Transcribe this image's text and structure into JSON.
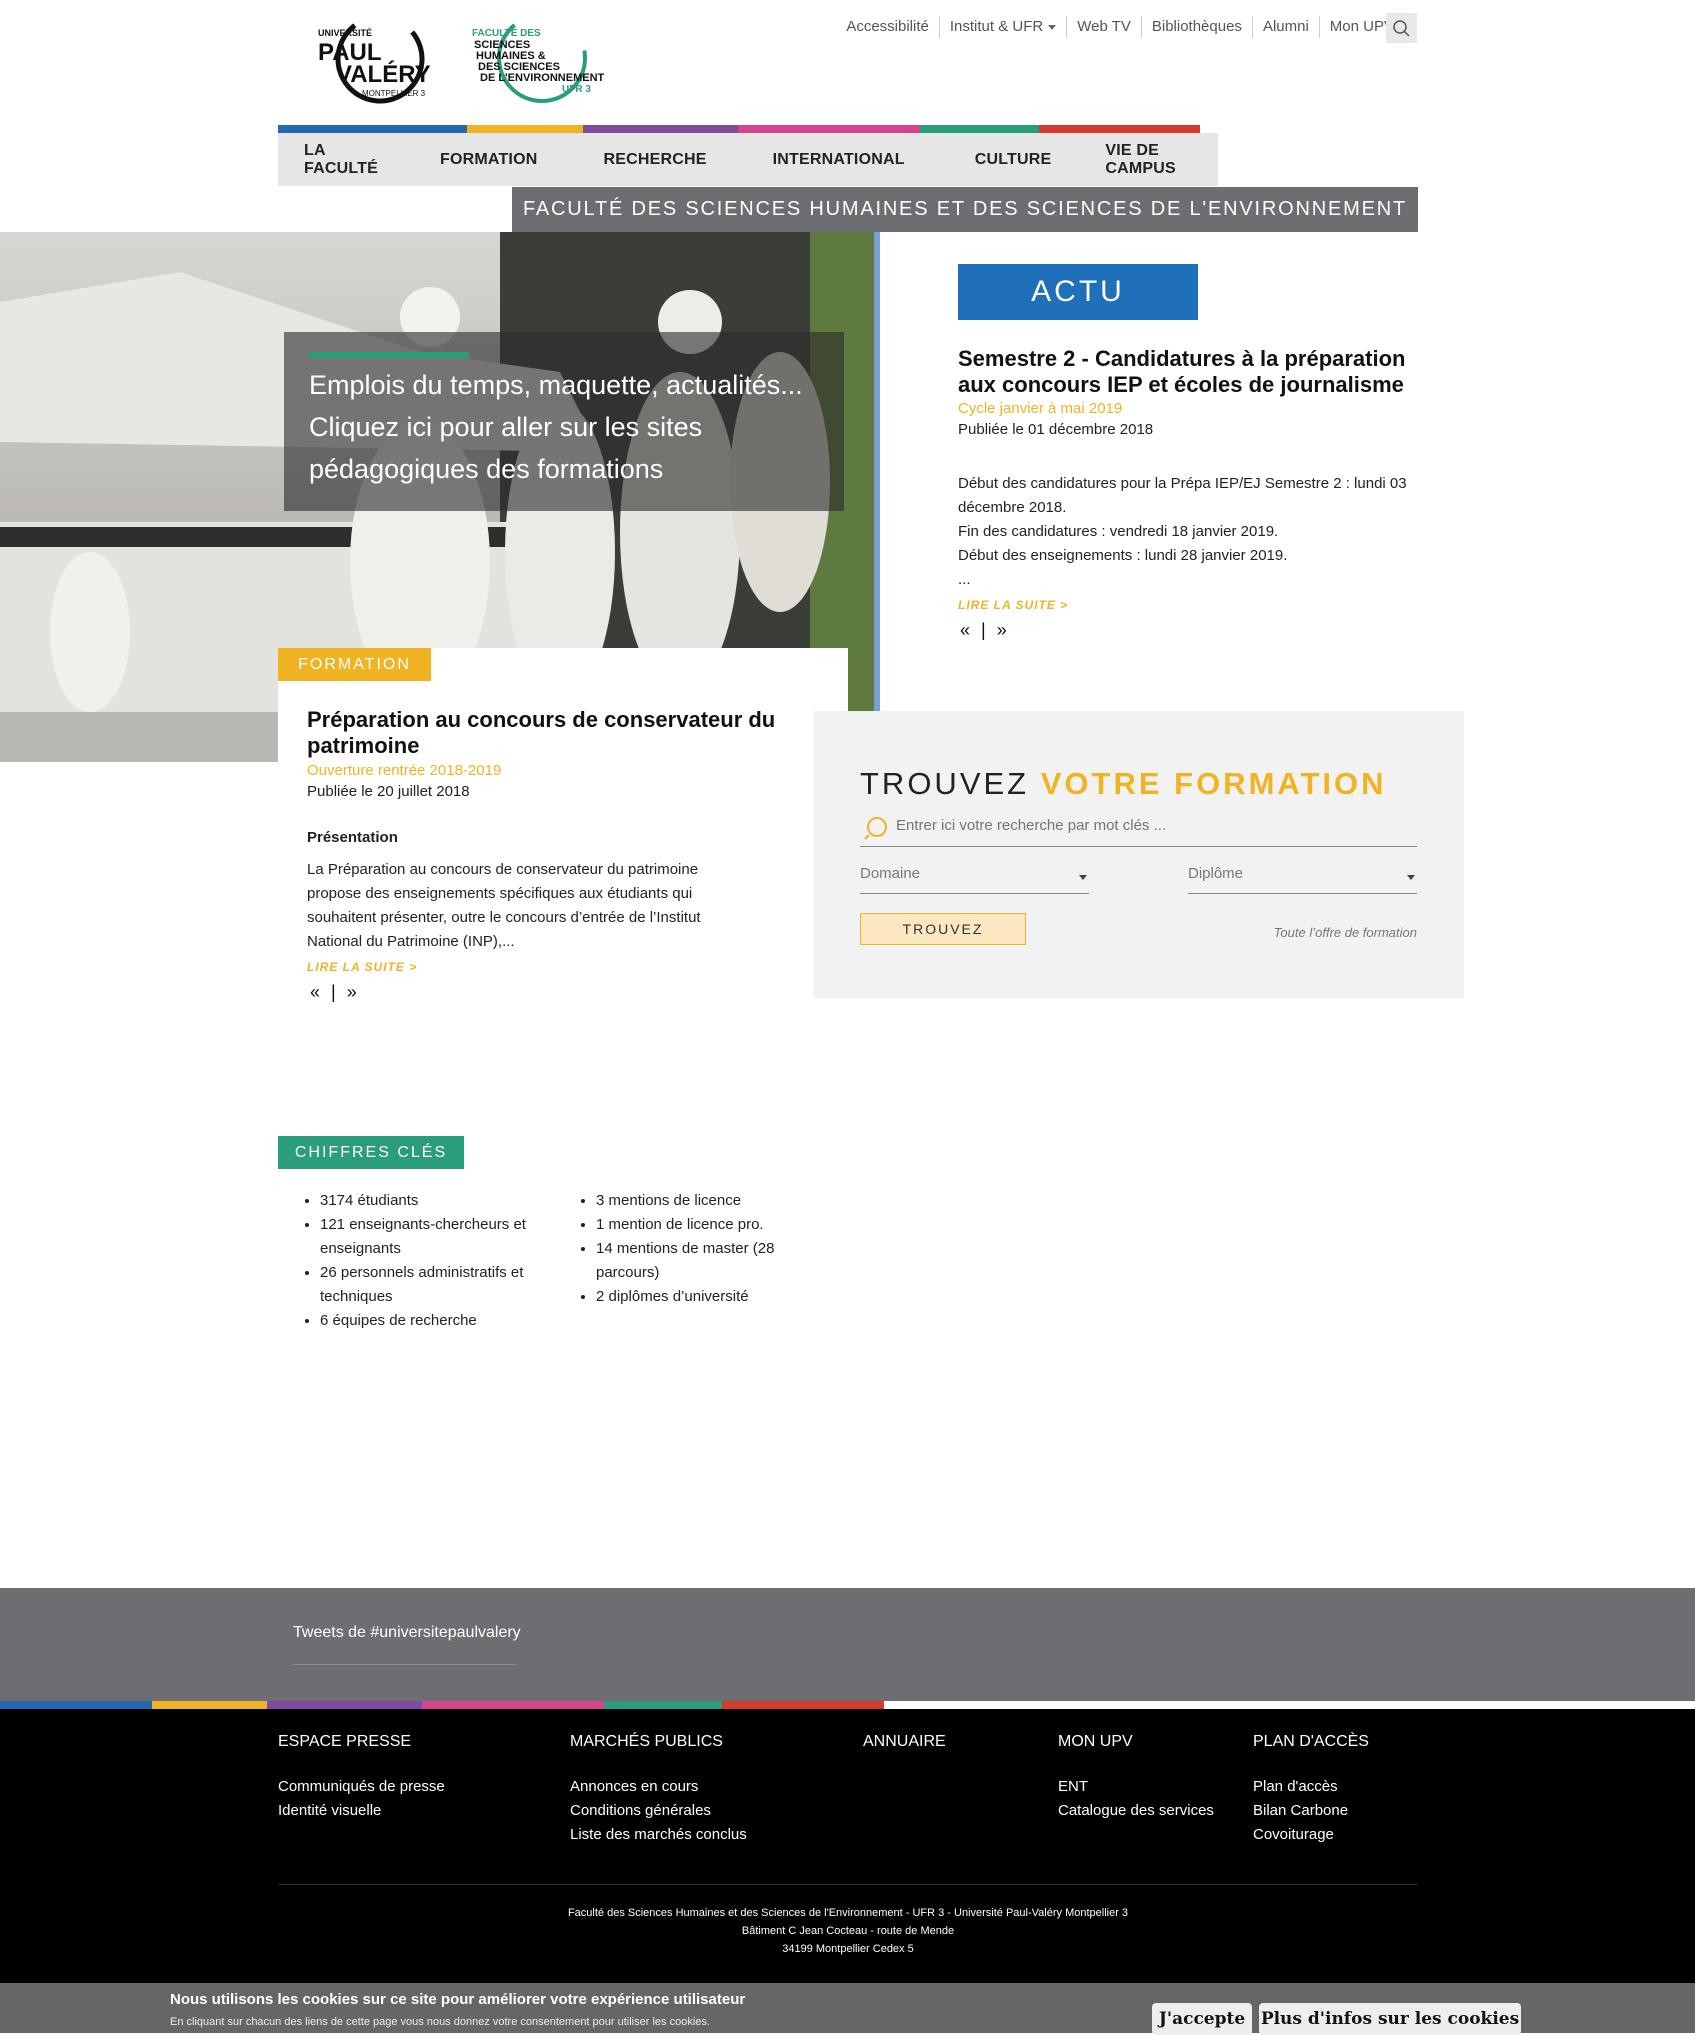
{
  "header": {
    "logo_upv_lines": [
      "UNIVERSITÉ",
      "PAUL",
      "VALÉRY",
      "MONTPELLIER 3"
    ],
    "logo_fac_lines": [
      "FACULTÉ DES",
      "SCIENCES",
      "HUMAINES &",
      "DES SCIENCES",
      "DE L'ENVIRONNEMENT",
      "UFR 3"
    ],
    "top_links": [
      "Accessibilité",
      "Institut & UFR",
      "Web TV",
      "Bibliothèques",
      "Alumni",
      "Mon UPV"
    ]
  },
  "colors": {
    "blue": "#2468b2",
    "yellow": "#f0b323",
    "purple": "#7e4c9c",
    "pink": "#d6448f",
    "teal": "#2a9d7c",
    "red": "#d63a2a",
    "gray": "#6d6e71"
  },
  "nav": {
    "items": [
      "LA FACULTÉ",
      "FORMATION",
      "RECHERCHE",
      "INTERNATIONAL",
      "CULTURE",
      "VIE DE CAMPUS"
    ],
    "faculty_banner": "FACULTÉ DES SCIENCES HUMAINES ET DES SCIENCES DE L'ENVIRONNEMENT"
  },
  "hero": {
    "text_lines": [
      "Emplois du temps, maquette, actualités...",
      "Cliquez ici pour aller sur les sites",
      "pédagogiques des formations"
    ]
  },
  "actu": {
    "badge": "ACTU",
    "title": "Semestre 2 - Candidatures à la préparation aux concours IEP et écoles de journalisme",
    "subtitle": "Cycle janvier à mai 2019",
    "published": "Publiée le 01 décembre 2018",
    "body": [
      "Début des candidatures pour la Prépa IEP/EJ Semestre 2 :  lundi 03 décembre 2018.",
      "Fin des candidatures : vendredi 18 janvier 2019.",
      "Début des enseignements : lundi 28 janvier 2019.",
      "..."
    ],
    "read_more": "LIRE LA SUITE  >",
    "prev": "«",
    "sep": "|",
    "next": "»"
  },
  "formation": {
    "badge": "FORMATION",
    "title": "Préparation au concours de conservateur du patrimoine",
    "subtitle": "Ouverture rentrée 2018-2019",
    "published": "Publiée le 20 juillet 2018",
    "section": "Présentation",
    "body": "La Préparation au concours de conservateur du patrimoine propose des enseignements spécifiques aux étudiants qui souhaitent présenter, outre le concours d’entrée de l’Institut National du Patrimoine (INP),...",
    "read_more": "LIRE LA SUITE  >",
    "prev": "«",
    "sep": "|",
    "next": "»"
  },
  "find": {
    "title_1": "TROUVEZ ",
    "title_2": "VOTRE FORMATION",
    "search_placeholder": "Entrer ici votre recherche par mot clés ...",
    "domain_label": "Domaine",
    "diploma_label": "Diplôme",
    "button": "TROUVEZ",
    "all_link": "Toute l’offre de formation"
  },
  "chiffres": {
    "badge": "CHIFFRES CLÉS",
    "col1": [
      "3174 étudiants",
      "121 enseignants-chercheurs et enseignants",
      "26 personnels administratifs et techniques",
      "6 équipes de recherche"
    ],
    "col2": [
      "3 mentions de licence",
      "1 mention de licence pro.",
      "14 mentions de master (28 parcours)",
      "2 diplômes d’université"
    ]
  },
  "tweets": {
    "link": "Tweets de #universitepaulvalery"
  },
  "footer": {
    "columns": [
      {
        "heading": "ESPACE PRESSE",
        "links": [
          "Communiqués de presse",
          "Identité visuelle"
        ]
      },
      {
        "heading": "MARCHÉS PUBLICS",
        "links": [
          "Annonces en cours",
          "Conditions générales",
          "Liste des marchés conclus"
        ]
      },
      {
        "heading": "ANNUAIRE",
        "links": []
      },
      {
        "heading": "MON UPV",
        "links": [
          "ENT",
          "Catalogue des services"
        ]
      },
      {
        "heading": "PLAN D'ACCÈS",
        "links": [
          "Plan d'accès",
          "Bilan Carbone",
          "Covoiturage"
        ]
      }
    ],
    "address": [
      "Faculté des Sciences Humaines et des Sciences de l'Environnement - UFR 3 - Université Paul-Valéry Montpellier 3",
      "Bâtiment C Jean Cocteau - route de Mende",
      "34199 Montpellier Cedex 5"
    ]
  },
  "cookie": {
    "title": "Nous utilisons les cookies sur ce site pour améliorer votre expérience utilisateur",
    "subtitle": "En cliquant sur chacun des liens de cette page vous nous donnez votre consentement pour utiliser les cookies.",
    "accept": "J'accepte",
    "more": "Plus d'infos sur les cookies"
  }
}
